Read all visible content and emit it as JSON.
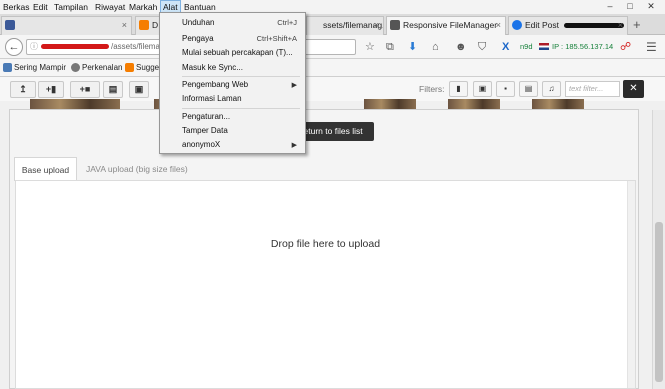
{
  "menubar": {
    "items": [
      "Berkas",
      "Edit",
      "Tampilan",
      "Riwayat",
      "Markah",
      "Alat",
      "Bantuan"
    ],
    "active": "Alat"
  },
  "window_controls": [
    "–",
    "□",
    "✕"
  ],
  "tabs": [
    {
      "label": "",
      "favicon_color": "#3b5998",
      "icon": "facebook-icon"
    },
    {
      "label": "D",
      "favicon_color": "#f57d00",
      "icon": "blogger-icon"
    },
    {
      "label": "ssets/filemanag...",
      "favicon_color": "#888888",
      "icon": "page-icon"
    },
    {
      "label": "Responsive FileManager",
      "favicon_color": "#555555",
      "icon": "filemanager-icon",
      "active": true
    },
    {
      "label": "Edit Post",
      "favicon_color": "#1a73e8",
      "icon": "loading-icon"
    }
  ],
  "newtab_label": "+",
  "url": {
    "path": "/assets/filema",
    "info_icon": "ⓘ"
  },
  "toolbar_icons": [
    "☆",
    "⧉",
    "⬇",
    "⌂",
    "☻",
    "⛉",
    "X"
  ],
  "proxy": {
    "label": "n9d",
    "ip": "IP : 185.56.137.14"
  },
  "bookmarks": [
    {
      "label": "Sering Mampir",
      "color": "#4a7ab5"
    },
    {
      "label": "Perkenalan",
      "color": "#777777"
    },
    {
      "label": "Sugge",
      "color": "#f57d00"
    }
  ],
  "dropdown": {
    "items": [
      {
        "label": "Unduhan",
        "shortcut": "Ctrl+J"
      },
      {
        "label": "Pengaya",
        "shortcut": "Ctrl+Shift+A"
      },
      {
        "label": "Mulai sebuah percakapan (T)...",
        "shortcut": ""
      },
      {
        "label": "Masuk ke Sync...",
        "shortcut": ""
      },
      {
        "label": "Pengembang Web",
        "submenu": true
      },
      {
        "label": "Informasi Laman",
        "shortcut": ""
      },
      {
        "label": "Pengaturan...",
        "shortcut": ""
      },
      {
        "label": "Tamper Data",
        "shortcut": ""
      },
      {
        "label": "anonymoX",
        "submenu": true
      }
    ]
  },
  "filemanager": {
    "filters_label": "Filters:",
    "filter_placeholder": "text filter...",
    "clear_label": "✕",
    "return_label": "Return to files list",
    "tabs": [
      "Base upload",
      "JAVA upload (big size files)"
    ],
    "drop_text": "Drop file here to upload"
  }
}
